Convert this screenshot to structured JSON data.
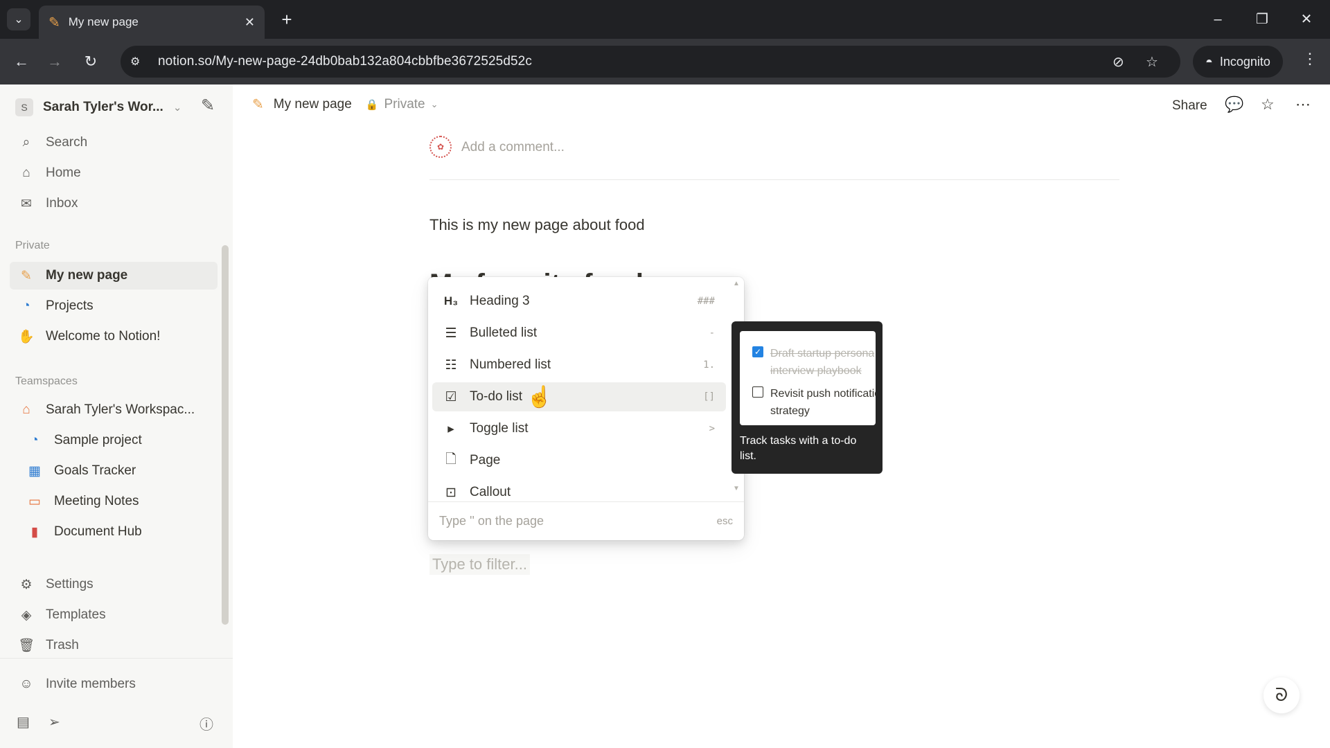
{
  "browser": {
    "tab_title": "My new page",
    "url": "notion.so/My-new-page-24db0bab132a804cbbfbe3672525d52c",
    "incognito_label": "Incognito"
  },
  "sidebar": {
    "workspace_name": "Sarah Tyler's Wor...",
    "workspace_initial": "S",
    "top_items": [
      {
        "label": "Search",
        "icon": "search-icon"
      },
      {
        "label": "Home",
        "icon": "home-icon"
      },
      {
        "label": "Inbox",
        "icon": "inbox-icon"
      }
    ],
    "private_label": "Private",
    "private_items": [
      {
        "label": "My new page",
        "icon": "pencil-icon"
      },
      {
        "label": "Projects",
        "icon": "projects-icon"
      },
      {
        "label": "Welcome to Notion!",
        "icon": "wave-icon"
      }
    ],
    "teamspaces_label": "Teamspaces",
    "teamspace_name": "Sarah Tyler's Workspac...",
    "teamspace_items": [
      {
        "label": "Sample project",
        "icon": "projects-icon"
      },
      {
        "label": "Goals Tracker",
        "icon": "chart-icon"
      },
      {
        "label": "Meeting Notes",
        "icon": "calendar-icon"
      },
      {
        "label": "Document Hub",
        "icon": "document-icon"
      }
    ],
    "bottom_items": [
      {
        "label": "Settings",
        "icon": "gear-icon"
      },
      {
        "label": "Templates",
        "icon": "templates-icon"
      },
      {
        "label": "Trash",
        "icon": "trash-icon"
      }
    ],
    "invite_label": "Invite members"
  },
  "topbar": {
    "page_title": "My new page",
    "visibility": "Private",
    "share_label": "Share"
  },
  "page": {
    "comment_placeholder": "Add a comment...",
    "paragraph": "This is my new page about food",
    "heading_partial": "My favorite foods",
    "filter_placeholder": "Type to filter..."
  },
  "slash_menu": {
    "items": [
      {
        "label": "Heading 3",
        "shortcut": "###",
        "icon": "heading3-icon"
      },
      {
        "label": "Bulleted list",
        "shortcut": "-",
        "icon": "bulleted-list-icon"
      },
      {
        "label": "Numbered list",
        "shortcut": "1.",
        "icon": "numbered-list-icon"
      },
      {
        "label": "To-do list",
        "shortcut": "[]",
        "icon": "todo-list-icon"
      },
      {
        "label": "Toggle list",
        "shortcut": ">",
        "icon": "toggle-list-icon"
      },
      {
        "label": "Page",
        "shortcut": "",
        "icon": "page-icon"
      },
      {
        "label": "Callout",
        "shortcut": "",
        "icon": "callout-icon"
      }
    ],
    "footer_hint": "Type '' on the page",
    "footer_esc": "esc"
  },
  "preview": {
    "todo_done": "Draft startup persona interview playbook",
    "todo_open": "Revisit push notification strategy",
    "caption": "Track tasks with a to-do list."
  }
}
